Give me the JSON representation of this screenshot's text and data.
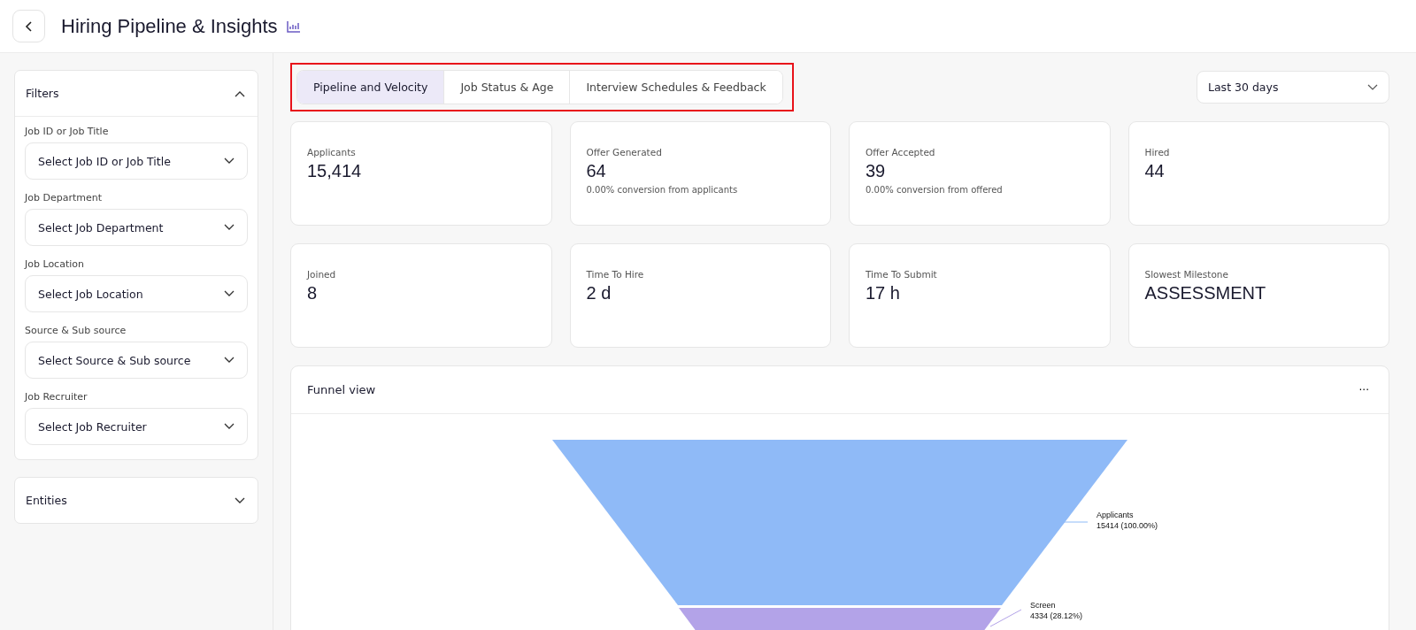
{
  "header": {
    "title": "Hiring Pipeline & Insights"
  },
  "filters": {
    "title": "Filters",
    "expanded": true,
    "fields": [
      {
        "label": "Job ID or Job Title",
        "placeholder": "Select Job ID or Job Title"
      },
      {
        "label": "Job Department",
        "placeholder": "Select Job Department"
      },
      {
        "label": "Job Location",
        "placeholder": "Select Job Location"
      },
      {
        "label": "Source & Sub source",
        "placeholder": "Select Source & Sub source"
      },
      {
        "label": "Job Recruiter",
        "placeholder": "Select Job Recruiter"
      }
    ]
  },
  "entities": {
    "title": "Entities",
    "expanded": false
  },
  "tabs": [
    {
      "label": "Pipeline and Velocity",
      "selected": true
    },
    {
      "label": "Job Status & Age",
      "selected": false
    },
    {
      "label": "Interview Schedules & Feedback",
      "selected": false
    }
  ],
  "date_range": {
    "value": "Last 30 days"
  },
  "metrics": [
    {
      "label": "Applicants",
      "value": "15,414"
    },
    {
      "label": "Offer Generated",
      "value": "64",
      "note": "0.00% conversion from applicants"
    },
    {
      "label": "Offer Accepted",
      "value": "39",
      "note": "0.00% conversion from offered"
    },
    {
      "label": "Hired",
      "value": "44"
    },
    {
      "label": "Joined",
      "value": "8"
    },
    {
      "label": "Time To Hire",
      "value": "2 d"
    },
    {
      "label": "Time To Submit",
      "value": "17 h"
    },
    {
      "label": "Slowest Milestone",
      "value": "ASSESSMENT"
    }
  ],
  "funnel": {
    "title": "Funnel view",
    "menu": "···",
    "stages": [
      {
        "name": "Applicants",
        "reading": "15414 (100.00%)",
        "color": "#8fbaf7"
      },
      {
        "name": "Screen",
        "reading": "4334 (28.12%)",
        "color": "#b3a3e8"
      }
    ]
  }
}
